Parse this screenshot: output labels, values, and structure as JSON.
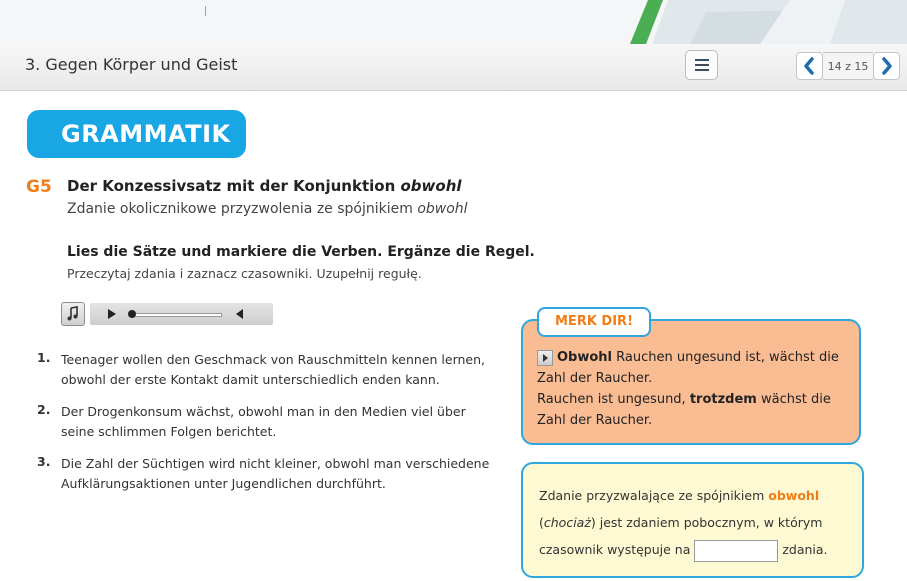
{
  "header": {
    "section_title": "3. Gegen Körper und Geist",
    "page_counter": "14 z 15",
    "icons": {
      "toc": "list-icon",
      "prev": "chevron-left-icon",
      "next": "chevron-right-icon"
    }
  },
  "badge": {
    "label": "GRAMMATIK"
  },
  "exercise": {
    "number": "G5",
    "title_de_prefix": "Der Konzessivsatz mit der Konjunktion ",
    "title_de_em": "obwohl",
    "title_pl_prefix": "Zdanie okolicznikowe przyzwolenia ze spójnikiem ",
    "title_pl_em": "obwohl",
    "instruction_de": "Lies die Sätze und markiere die Verben. Ergänze die Regel.",
    "instruction_pl": "Przeczytaj zdania i zaznacz czasowniki. Uzupełnij regułę."
  },
  "audio_player": {
    "icons": [
      "music-icon",
      "play-icon",
      "volume-icon"
    ]
  },
  "sentences": [
    {
      "num": "1.",
      "text": "Teenager wollen den Geschmack von Rauschmitteln kennen lernen, obwohl der erste Kontakt damit unterschiedlich enden kann."
    },
    {
      "num": "2.",
      "text": "Der Drogenkonsum wächst, obwohl man in den Medien viel über seine schlimmen Folgen berichtet."
    },
    {
      "num": "3.",
      "text": "Die Zahl der Süchtigen wird nicht kleiner, obwohl man verschiedene Aufklärungsaktionen unter Jugendlichen durchführt."
    }
  ],
  "merk": {
    "title": "MERK DIR!",
    "line1_bold": "Obwohl",
    "line1_rest": " Rauchen ungesund ist, wächst die Zahl der Raucher.",
    "line2_pre": "Rauchen ist ungesund, ",
    "line2_bold": "trotzdem",
    "line2_post": " wächst die Zahl der Raucher."
  },
  "rule": {
    "part1": "Zdanie przyzwalające ze spójnikiem ",
    "keyword": "obwohl",
    "part2_open": " (",
    "part2_em": "chociaż",
    "part2_rest": ") jest zdaniem pobocznym, w którym czasownik występuje na ",
    "input_value": "",
    "part3": " zdania."
  },
  "colors": {
    "accent_blue": "#19a6e4",
    "accent_orange": "#f07d1b",
    "merk_bg": "#f9bc93",
    "rule_bg": "#fdf9d2"
  }
}
